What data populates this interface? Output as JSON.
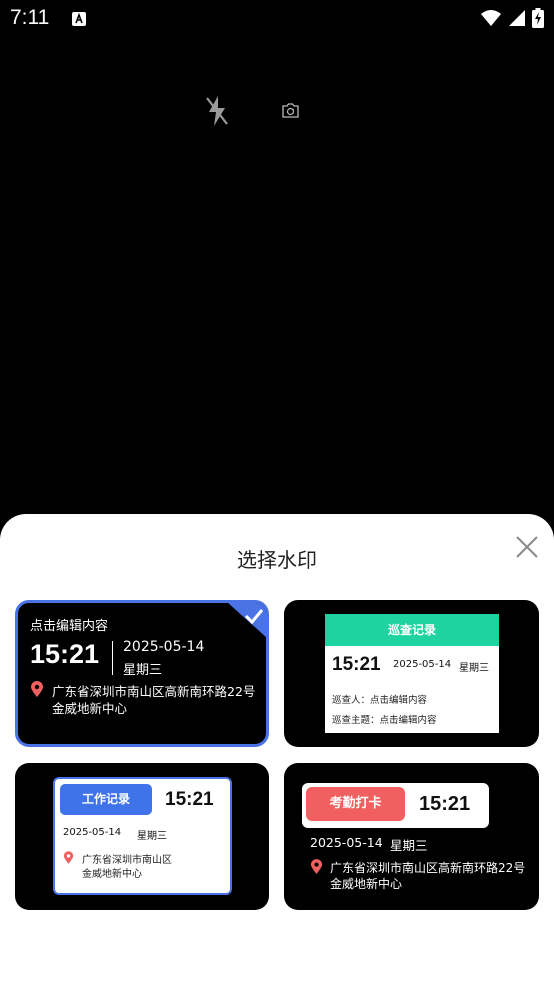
{
  "status_bar": {
    "time": "7:11",
    "notification_icon": "a-letter-icon",
    "icons": [
      "wifi-icon",
      "signal-icon",
      "battery-charging-icon"
    ]
  },
  "camera": {
    "flash_icon": "flash-off-icon",
    "switch_icon": "switch-camera-icon"
  },
  "sheet": {
    "title": "选择水印",
    "close_icon": "close-icon"
  },
  "colors": {
    "selected_border": "#4a73e6",
    "inspection_header": "#1fd3a0",
    "work_badge": "#3f73ea",
    "attendance_badge": "#f16060",
    "pin": "#f16060"
  },
  "watermarks": [
    {
      "selected": true,
      "edit_text": "点击编辑内容",
      "time": "15:21",
      "date": "2025-05-14",
      "weekday": "星期三",
      "address_line1": "广东省深圳市南山区高新南环路22号",
      "address_line2": "金威地新中心"
    },
    {
      "selected": false,
      "header": "巡查记录",
      "time": "15:21",
      "date": "2025-05-14",
      "weekday": "星期三",
      "inspector": "巡查人：点击编辑内容",
      "subject": "巡查主题：点击编辑内容"
    },
    {
      "selected": false,
      "badge": "工作记录",
      "time": "15:21",
      "date": "2025-05-14",
      "weekday": "星期三",
      "address_line1": "广东省深圳市南山区",
      "address_line2": "金威地新中心"
    },
    {
      "selected": false,
      "badge": "考勤打卡",
      "time": "15:21",
      "date": "2025-05-14",
      "weekday": "星期三",
      "address_line1": "广东省深圳市南山区高新南环路22号",
      "address_line2": "金威地新中心"
    }
  ]
}
